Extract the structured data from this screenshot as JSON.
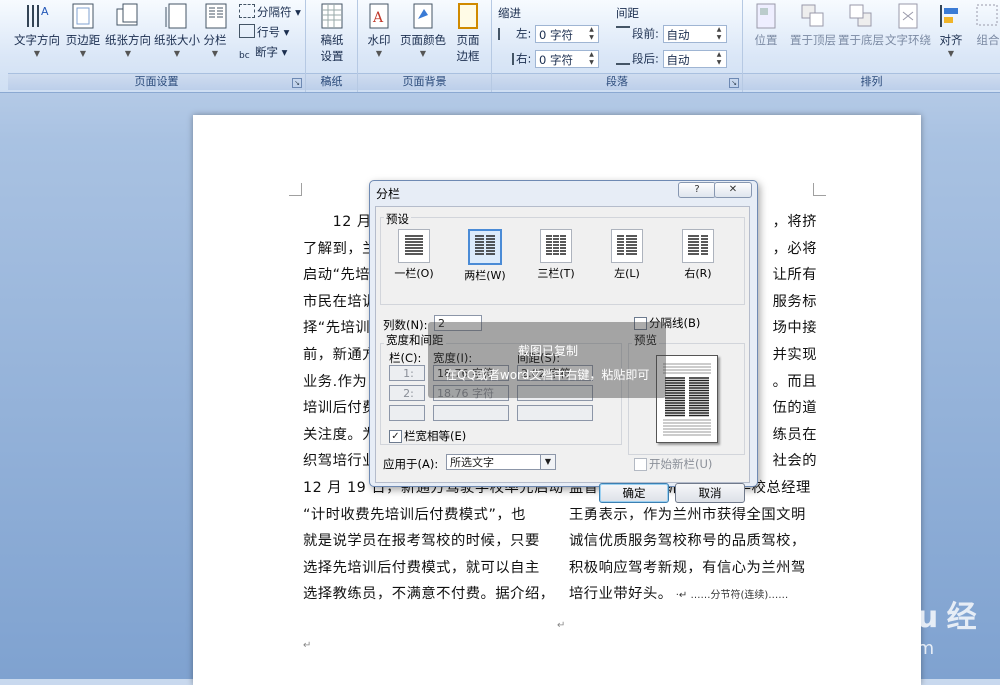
{
  "ribbon": {
    "page_setup": {
      "label": "页面设置",
      "text_direction": "文字方向",
      "margins": "页边距",
      "orientation": "纸张方向",
      "size": "纸张大小",
      "columns": "分栏",
      "breaks": "分隔符",
      "line_numbers": "行号",
      "hyphenation": "断字"
    },
    "draft_paper": {
      "label": "稿纸",
      "button": "稿纸\n设置"
    },
    "page_background": {
      "label": "页面背景",
      "watermark": "水印",
      "page_color": "页面颜色",
      "page_borders": "页面\n边框"
    },
    "paragraph": {
      "label": "段落",
      "indent_title": "缩进",
      "indent_left_label": "左:",
      "indent_left_value": "0 字符",
      "indent_right_label": "右:",
      "indent_right_value": "0 字符",
      "spacing_title": "间距",
      "spacing_before_label": "段前:",
      "spacing_before_value": "自动",
      "spacing_after_label": "段后:",
      "spacing_after_value": "自动"
    },
    "arrange": {
      "label": "排列",
      "position": "位置",
      "bring_front": "置于顶层",
      "send_back": "置于底层",
      "wrap": "文字环绕",
      "align": "对齐",
      "group": "组合"
    }
  },
  "document": {
    "left_column": [
      "12 月 1",
      "了解到，兰",
      "启动“先培",
      "市民在培训",
      "择“先培训",
      "前，新通方",
      "业务.作为",
      "培训后付费",
      "关注度。为",
      "织驾培行业",
      "12 月 19 日，新通方驾驶学校率先启动",
      "“计时收费先培训后付费模式”，也",
      "就是说学员在报考驾校的时候，只要",
      "选择先培训后付费模式，就可以自主",
      "选择教练员，不满意不付费。据介绍，"
    ],
    "right_column": [
      "，将挤",
      "，必将",
      "让所有",
      "服务标",
      "场中接",
      "并实现",
      "。而且",
      "伍的道",
      "练员在",
      "社会的",
      "监督与选择。 新通方驾驶学校总经理",
      "王勇表示，作为兰州市获得全国文明",
      "诚信优质服务驾校称号的品质驾校，",
      "积极响应驾考新规，有信心为兰州驾",
      "培行业带好头。"
    ],
    "section_break": "分节符(连续)"
  },
  "dialog": {
    "title": "分栏",
    "help": "?",
    "close": "✕",
    "presets_title": "预设",
    "presets": [
      "一栏(O)",
      "两栏(W)",
      "三栏(T)",
      "左(L)",
      "右(R)"
    ],
    "num_columns_label": "列数(N):",
    "num_columns_value": "2",
    "separator_label": "分隔线(B)",
    "width_spacing_title": "宽度和间距",
    "col_header": "栏(C):",
    "width_header": "宽度(I):",
    "spacing_header": "间距(S):",
    "rows": [
      {
        "col": "1:",
        "width": "18.76 字符",
        "spacing": "2.02 字符"
      },
      {
        "col": "2:",
        "width": "18.76 字符",
        "spacing": ""
      }
    ],
    "equal_width_label": "栏宽相等(E)",
    "apply_to_label": "应用于(A):",
    "apply_to_value": "所选文字",
    "preview_title": "预览",
    "start_new_col_label": "开始新栏(U)",
    "ok": "确定",
    "cancel": "取消"
  },
  "overlay": {
    "title": "截图已复制",
    "text": "在QQ或者word文档中右键，粘贴即可"
  },
  "watermark": {
    "brand": "Baidu 经验",
    "url": "jingyan.baidu.com"
  }
}
